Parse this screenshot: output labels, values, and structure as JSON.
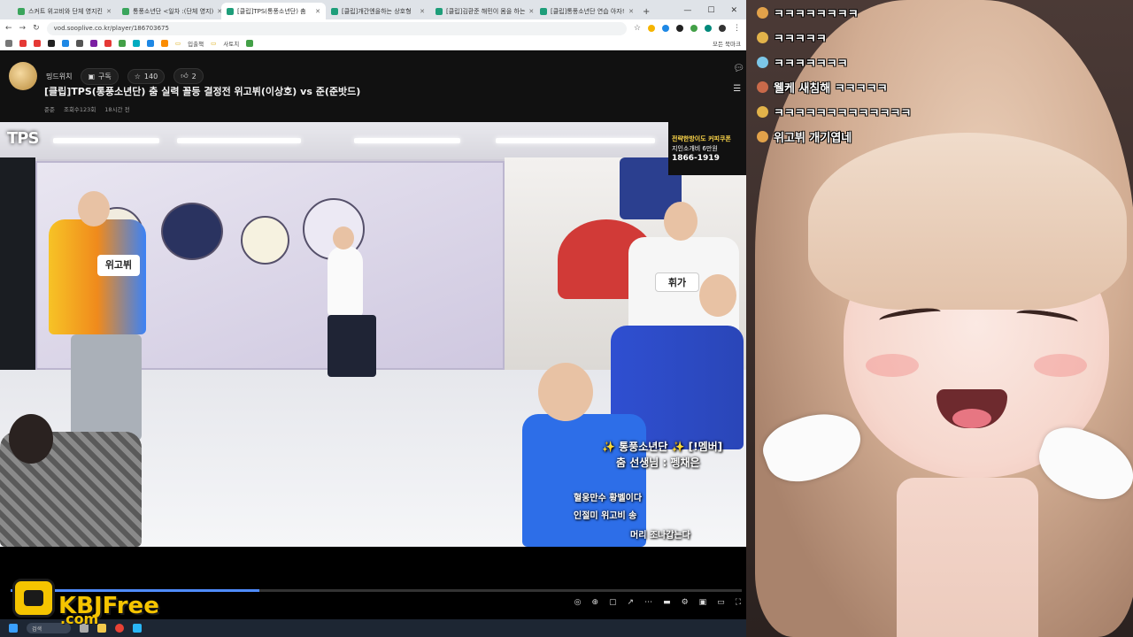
{
  "browser": {
    "tabs": [
      {
        "label": "스커트 위고비와 단체 영지킨",
        "active": false,
        "color": "#3aa55c"
      },
      {
        "label": "통풍소년단 <일차 :(단체 영지)",
        "active": false,
        "color": "#3aa55c"
      },
      {
        "label": "[클립]TPS(통풍소년단) 춤",
        "active": true,
        "color": "#1e9e7a"
      },
      {
        "label": "[클립]개간엔을하는 상호형",
        "active": false,
        "color": "#1e9e7a"
      },
      {
        "label": "[클립]김환준 해민이 몸을 하는",
        "active": false,
        "color": "#1e9e7a"
      },
      {
        "label": "[클립]통풍소년단 연습 아자!",
        "active": false,
        "color": "#1e9e7a"
      }
    ],
    "new_tab": "+",
    "window_controls": [
      "—",
      "☐",
      "✕"
    ],
    "url": "vod.sooplive.co.kr/player/186703675",
    "bookmarks": [
      {
        "label": "",
        "color": "#e53935"
      },
      {
        "label": "",
        "color": "#e53935"
      },
      {
        "label": "",
        "color": "#222"
      },
      {
        "label": "",
        "color": "#1e88e5"
      },
      {
        "label": "",
        "color": "#555"
      },
      {
        "label": "",
        "color": "#7b1fa2"
      },
      {
        "label": "",
        "color": "#e53935"
      },
      {
        "label": "",
        "color": "#43a047"
      },
      {
        "label": "",
        "color": "#00acc1"
      },
      {
        "label": "",
        "color": "#1e88e5"
      },
      {
        "label": "",
        "color": "#fb8c00"
      },
      {
        "label": "",
        "color": "#5e35b1"
      }
    ],
    "bookmark_folders": [
      "입출책",
      "사토치"
    ],
    "other_bookmarks": "모든 북마크"
  },
  "channel": {
    "name": "밍드위치",
    "subscribe": "구독",
    "likes": "140",
    "shares": "2"
  },
  "video": {
    "title": "[클립]TPS(통풍소년단) 춤 실력 꼴등 결정전 위고뷔(이상호) vs 준(준밧드)",
    "uploader": "준준",
    "views": "조회수123회",
    "time_ago": "18시간 전",
    "logo": "TPS",
    "ad": {
      "line1": "전략한방이도 커피쿠폰",
      "line2": "지인소개비 6만원",
      "phone": "1866-1919"
    },
    "name_tags": [
      "위고뷔",
      "휘가"
    ],
    "subtitles": {
      "group": "✨ 통풍소년단 ✨ [!멤버]",
      "teacher": "춤 선생님 : 펭채은",
      "line1": "혈웅만수 황벨이다",
      "line2": "인절미 위고비 송",
      "line3": "머리 조나갑는다"
    },
    "progress": 0.34
  },
  "watermark": {
    "brand": "KBJFree",
    "domain": ".com"
  },
  "taskbar": {
    "search": "검색"
  },
  "chat": [
    {
      "text": "ㅋㅋㅋㅋㅋㅋㅋㅋ",
      "badge_color": "#e2a24a"
    },
    {
      "text": "ㅋㅋㅋㅋㅋ",
      "badge_color": "#e2b34a"
    },
    {
      "text": "ㅋㅋㅋㅋㅋㅋㅋ",
      "badge_color": "#7cc7e8"
    },
    {
      "text": "웰케 새침해 ㅋㅋㅋㅋㅋ",
      "badge_color": "#c96a4a"
    },
    {
      "text": "ㅋㅋㅋㅋㅋㅋㅋㅋㅋㅋㅋㅋㅋ",
      "badge_color": "#e2b34a"
    },
    {
      "text": "위고뷔 개기엽네",
      "badge_color": "#e2a24a"
    }
  ]
}
